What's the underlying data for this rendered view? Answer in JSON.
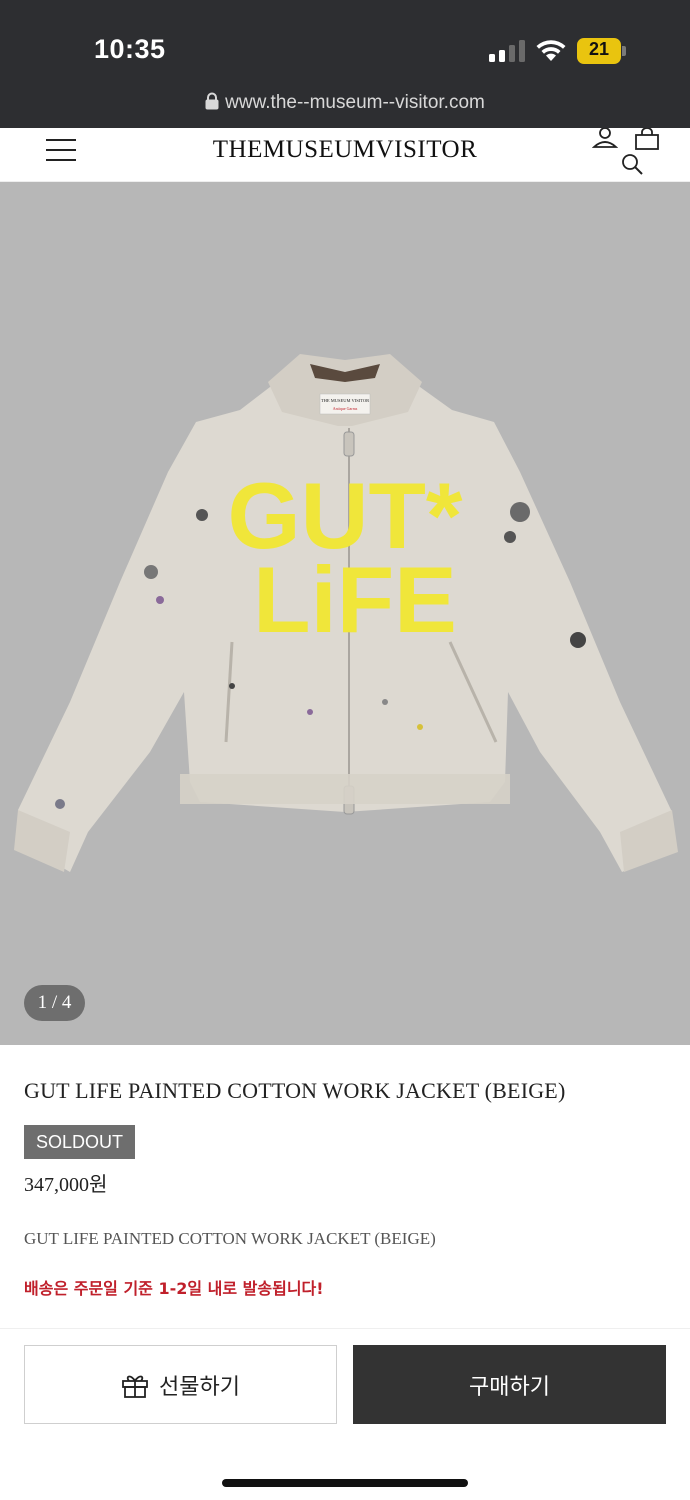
{
  "status_bar": {
    "time": "10:35",
    "battery_level": "21",
    "battery_color": "#e9c40f",
    "icons": [
      "signal-icon",
      "wifi-icon",
      "battery-icon"
    ]
  },
  "browser": {
    "url": "www.the--museum--visitor.com"
  },
  "header": {
    "brand": "THEMUSEUMVISITOR",
    "icons": [
      "menu-icon",
      "user-icon",
      "bag-icon",
      "search-icon"
    ]
  },
  "gallery": {
    "counter": "1 / 4",
    "print_line1": "GUT*",
    "print_line2": "LiFE",
    "label_line1": "THE MUSEUM VISITOR",
    "label_line2": "Antique Garms",
    "background_color": "#b7b7b7"
  },
  "product": {
    "title": "GUT LIFE PAINTED COTTON WORK JACKET (BEIGE)",
    "badge": "SOLDOUT",
    "price": "347,000원",
    "summary": "GUT LIFE PAINTED COTTON WORK JACKET (BEIGE)",
    "shipping_notice": "배송은 주문일 기준 1-2일 내로 발송됩니다!",
    "notice_color": "#c0202b"
  },
  "actions": {
    "gift_label": "선물하기",
    "buy_label": "구매하기",
    "gift_icon": "gift-icon"
  }
}
